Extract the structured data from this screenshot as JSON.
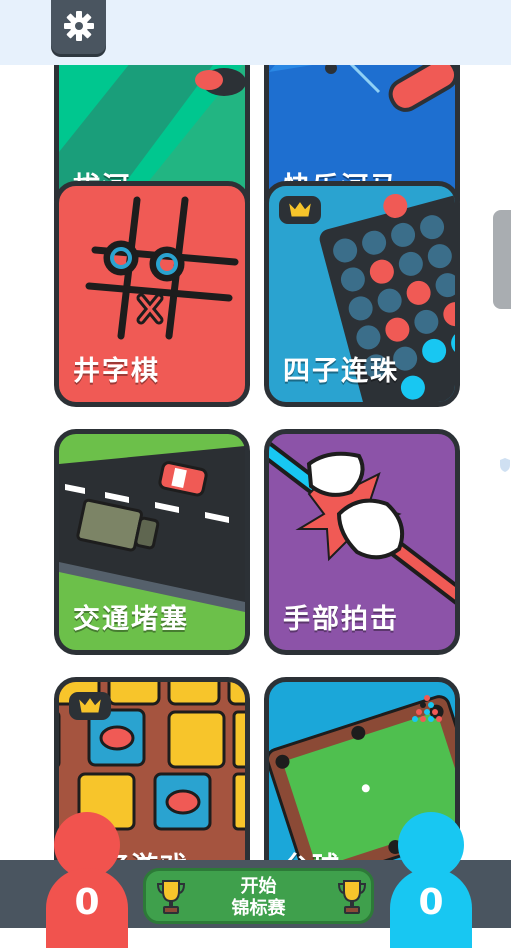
{
  "settings": {
    "icon": "gear-icon"
  },
  "games": [
    {
      "label": "拔河",
      "color": "#00c78f"
    },
    {
      "label": "快乐河马",
      "color": "#1e6fd0"
    },
    {
      "label": "井字棋",
      "color": "#f05a55"
    },
    {
      "label": "四子连珠",
      "color": "#2aa3d0",
      "premium": true
    },
    {
      "label": "交通堵塞",
      "color": "#2b2f33"
    },
    {
      "label": "手部拍击",
      "color": "#8c53a8"
    },
    {
      "label": "记忆游戏",
      "color": "#a5543f",
      "premium": true
    },
    {
      "label": "台球",
      "color": "#1ba7d9"
    }
  ],
  "scores": {
    "red": "0",
    "blue": "0"
  },
  "colors": {
    "red_player": "#f1534e",
    "blue_player": "#18c7f2"
  },
  "start_button": {
    "line1": "开始",
    "line2": "锦标赛"
  }
}
